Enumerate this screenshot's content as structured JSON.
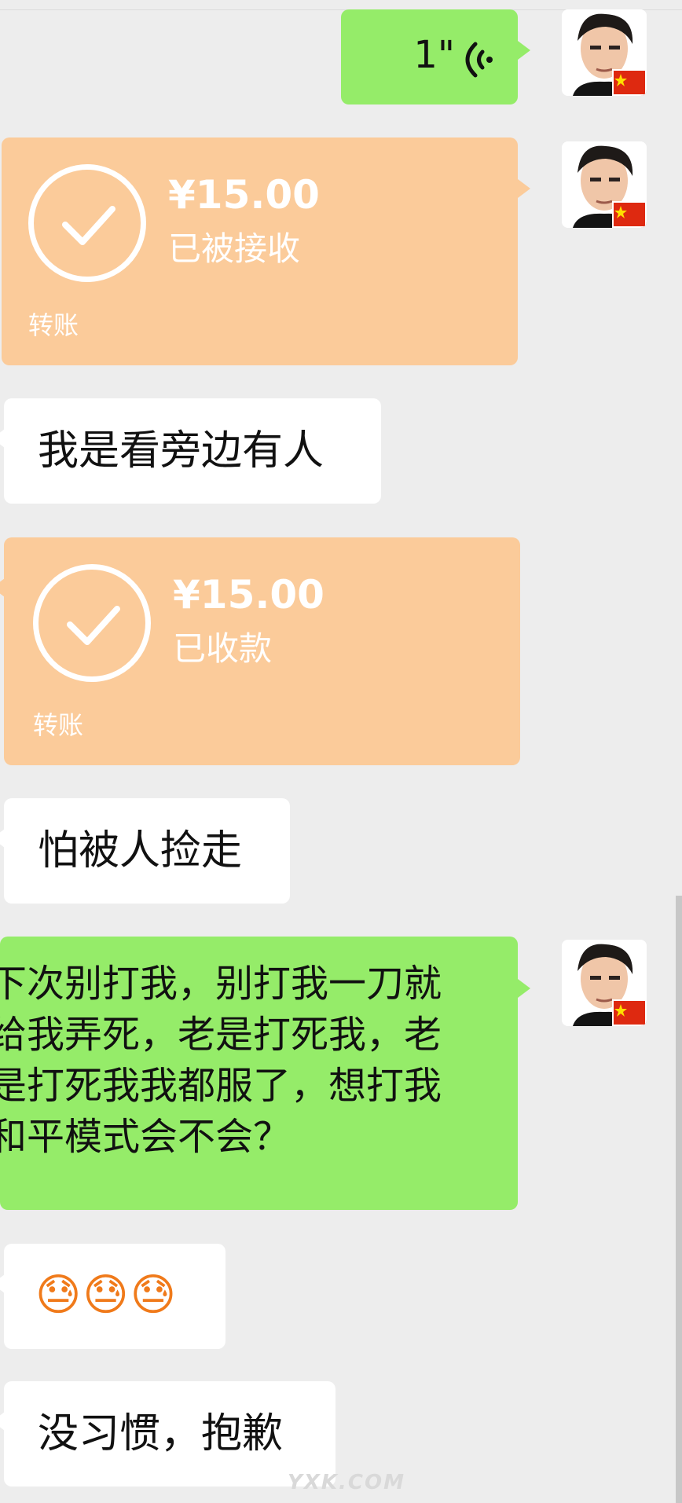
{
  "messages": {
    "voice": {
      "duration": "1\""
    },
    "transfer1": {
      "amount": "¥15.00",
      "status": "已被接收",
      "label": "转账"
    },
    "msg1": {
      "text": "我是看旁边有人"
    },
    "transfer2": {
      "amount": "¥15.00",
      "status": "已收款",
      "label": "转账"
    },
    "msg2": {
      "text": "怕被人捡走"
    },
    "long_msg": {
      "lines": [
        "下次别打我，别打我一刀就",
        "给我弄死，老是打死我，老",
        "是打死我我都服了，想打我",
        "和平模式会不会？"
      ]
    },
    "msg3": {
      "emoji": "😓😓😓"
    },
    "msg4": {
      "text": "没习惯，抱歉"
    }
  },
  "watermark": {
    "text": "YXK.COM"
  },
  "colors": {
    "background": "#ededed",
    "sent_bubble": "#95ec69",
    "received_bubble": "#ffffff",
    "transfer_bubble": "#fbcb9a"
  },
  "icons": {
    "voice": "voice-wave-icon",
    "transfer": "check-circle-icon",
    "avatar_badge": "china-flag-icon"
  }
}
